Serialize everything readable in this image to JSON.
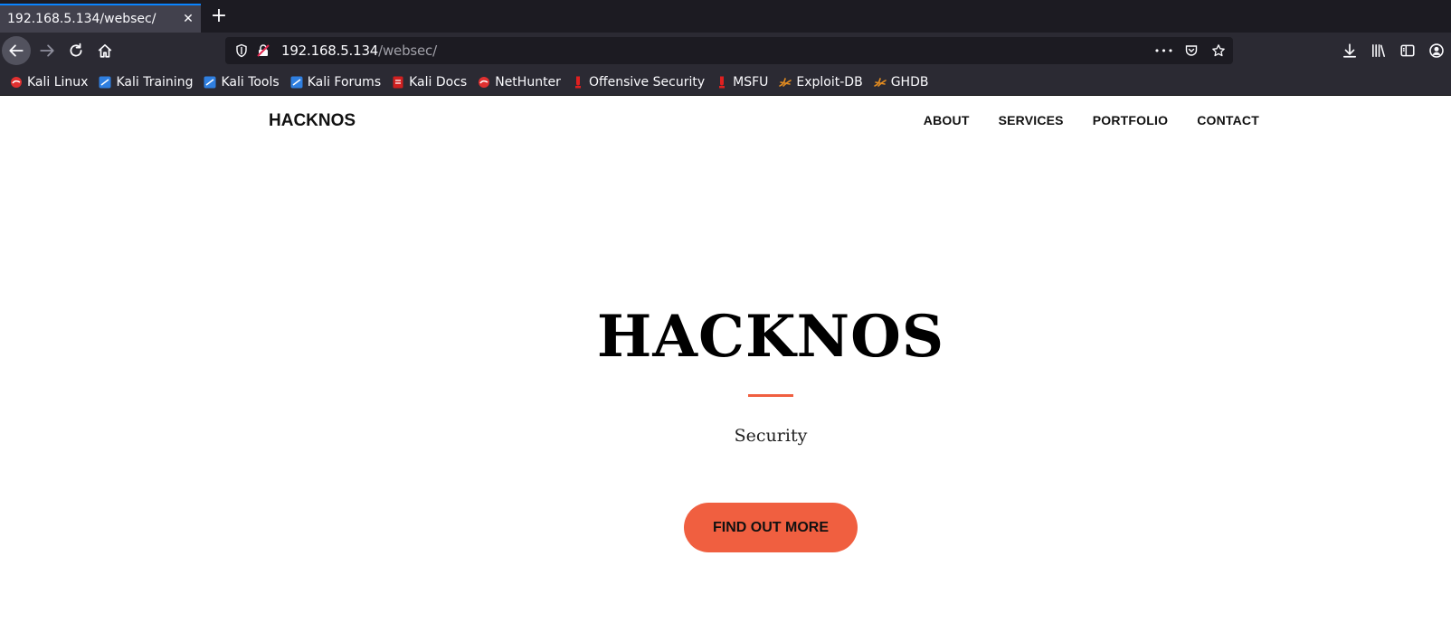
{
  "browser": {
    "tab": {
      "title": "192.168.5.134/websec/",
      "close_glyph": "✕"
    },
    "new_tab_glyph": "+",
    "url": {
      "host": "192.168.5.134",
      "path": "/websec/"
    },
    "url_more_glyph": "•••",
    "bookmarks": [
      {
        "label": "Kali Linux",
        "icon": "kali-dragon-icon",
        "color": "#e03030"
      },
      {
        "label": "Kali Training",
        "icon": "kali-training-icon",
        "color": "#2f7fe0"
      },
      {
        "label": "Kali Tools",
        "icon": "kali-tools-icon",
        "color": "#2f7fe0"
      },
      {
        "label": "Kali Forums",
        "icon": "kali-forums-icon",
        "color": "#2f7fe0"
      },
      {
        "label": "Kali Docs",
        "icon": "kali-docs-icon",
        "color": "#d02020"
      },
      {
        "label": "NetHunter",
        "icon": "nethunter-icon",
        "color": "#e03030"
      },
      {
        "label": "Offensive Security",
        "icon": "offsec-icon",
        "color": "#e02020"
      },
      {
        "label": "MSFU",
        "icon": "msfu-icon",
        "color": "#e02020"
      },
      {
        "label": "Exploit-DB",
        "icon": "exploitdb-icon",
        "color": "#e08a20"
      },
      {
        "label": "GHDB",
        "icon": "ghdb-icon",
        "color": "#e08a20"
      }
    ]
  },
  "site": {
    "brand": "HACKNOS",
    "menu": [
      "ABOUT",
      "SERVICES",
      "PORTFOLIO",
      "CONTACT"
    ],
    "hero": {
      "title": "HACKNOS",
      "subtitle": "Security",
      "button": "FIND OUT MORE"
    },
    "accent_color": "#f05f40"
  }
}
